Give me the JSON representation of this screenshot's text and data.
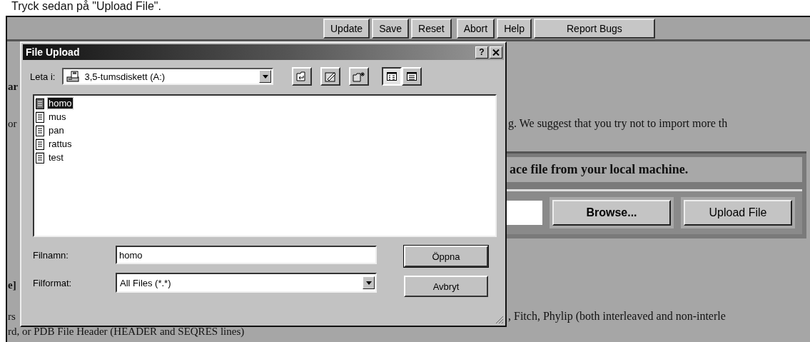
{
  "caption": "Tryck sedan på \"Upload File\".",
  "toolbar": {
    "buttons": [
      "Update",
      "Save",
      "Reset",
      "Abort",
      "Help",
      "Report Bugs"
    ]
  },
  "page": {
    "heading_1": "ar",
    "text_1_left": "or",
    "text_1_right": "g. We suggest that you try not to import more th",
    "upload_box": {
      "prompt": "ace file from your local machine.",
      "browse": "Browse...",
      "upload": "Upload File"
    },
    "heading_2": "e]",
    "text_2_left": "rs",
    "text_2_right": ", Fitch, Phylip (both interleaved and non-interle",
    "text_3": "rd, or PDB File Header (HEADER and SEQRES lines)"
  },
  "dialog": {
    "title": "File Upload",
    "help": "?",
    "look_in": {
      "label": "Leta i:",
      "value": "3,5-tumsdiskett (A:)"
    },
    "views": [
      {
        "kind": "list",
        "selected": true
      },
      {
        "kind": "details",
        "selected": false
      }
    ],
    "files": [
      {
        "name": "homo",
        "selected": true
      },
      {
        "name": "mus",
        "selected": false
      },
      {
        "name": "pan",
        "selected": false
      },
      {
        "name": "rattus",
        "selected": false
      },
      {
        "name": "test",
        "selected": false
      }
    ],
    "filename": {
      "label": "Filnamn:",
      "value": "homo"
    },
    "filetype": {
      "label": "Filformat:",
      "value": "All Files (*.*)"
    },
    "buttons": [
      "Öppna",
      "Avbryt"
    ]
  }
}
